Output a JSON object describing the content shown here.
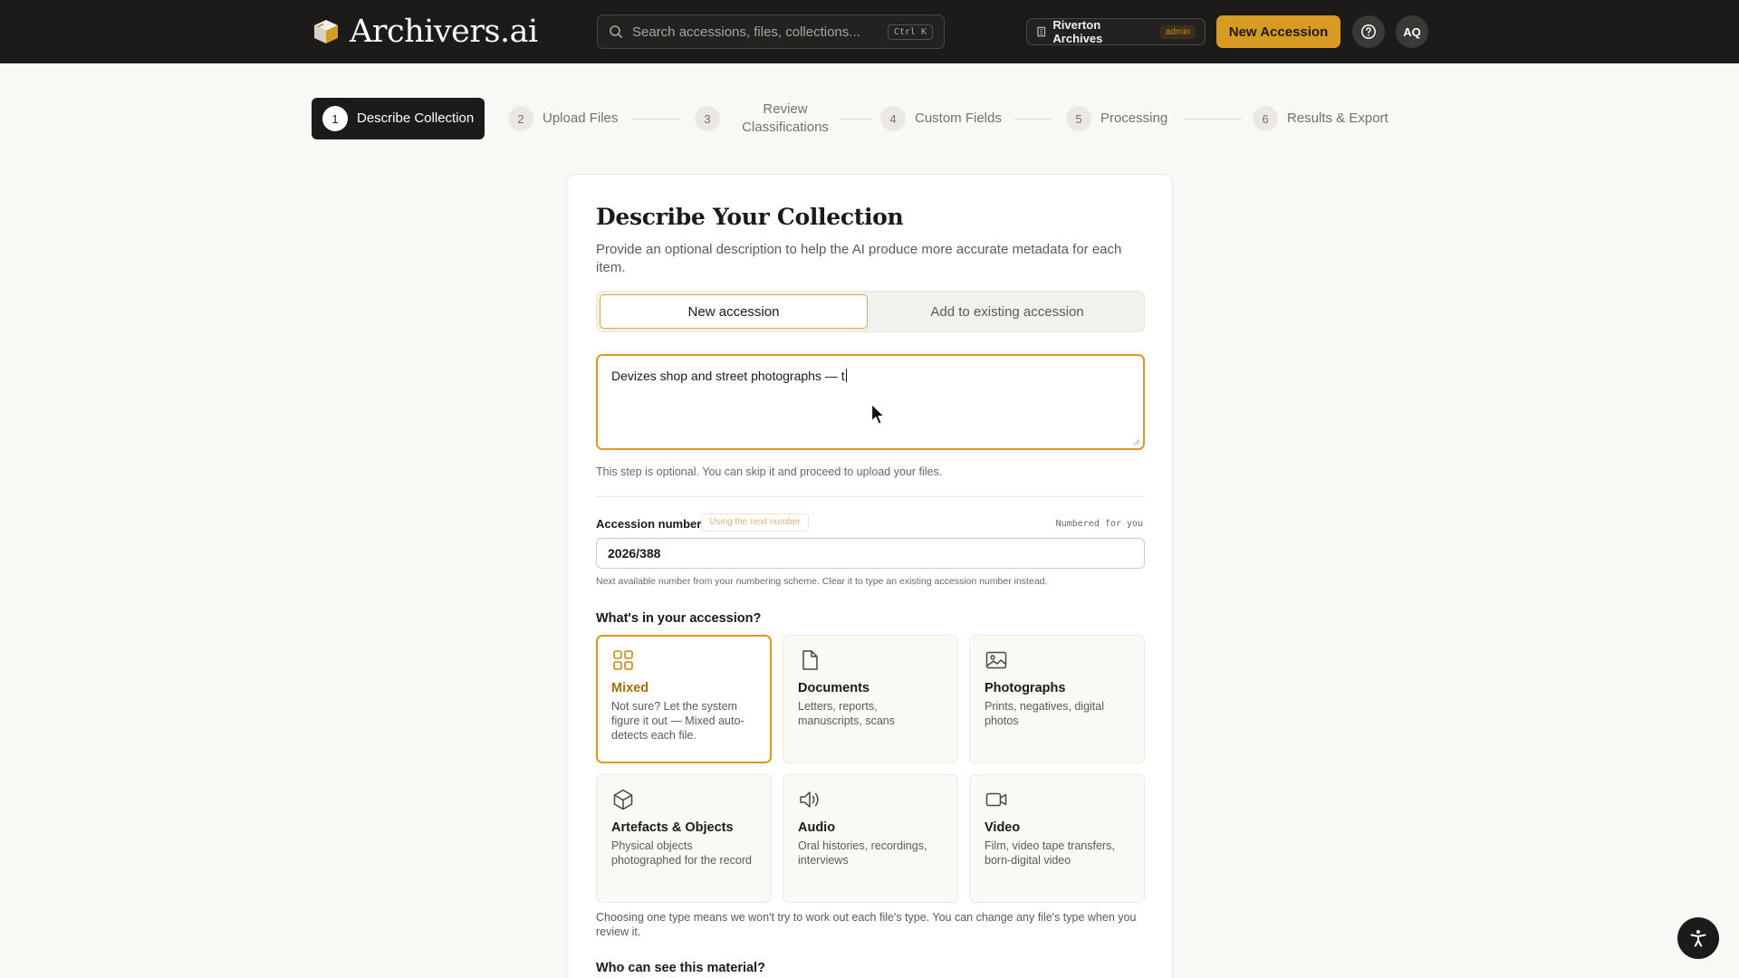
{
  "header": {
    "brand": "Archivers.ai",
    "search_placeholder": "Search accessions, files, collections...",
    "search_shortcut": "Ctrl K",
    "org_name": "Riverton Archives",
    "org_role": "admin",
    "new_accession_label": "New Accession",
    "avatar_initials": "AQ",
    "accent_color": "#d79a22"
  },
  "stepper": {
    "steps": [
      {
        "number": "1",
        "label": "Describe Collection",
        "active": true
      },
      {
        "number": "2",
        "label": "Upload Files"
      },
      {
        "number": "3",
        "label": "Review Classifications"
      },
      {
        "number": "4",
        "label": "Custom Fields"
      },
      {
        "number": "5",
        "label": "Processing"
      },
      {
        "number": "6",
        "label": "Results & Export"
      }
    ]
  },
  "main": {
    "title": "Describe Your Collection",
    "subtitle": "Provide an optional description to help the AI produce more accurate metadata for each item.",
    "mode_tabs": [
      "New accession",
      "Add to existing accession"
    ],
    "active_mode": "New accession",
    "description_value": "Devizes shop and street photographs — t",
    "optional_note": "This step is optional. You can skip it and proceed to upload your files.",
    "accession": {
      "label": "Accession number",
      "badge": "Using the next number",
      "hint": "Numbered for you",
      "value": "2026/388",
      "help": "Next available number from your numbering scheme. Clear it to type an existing accession number instead."
    },
    "type_question": "What's in your accession?",
    "types": [
      {
        "icon": "grid-icon",
        "title": "Mixed",
        "desc": "Not sure? Let the system figure it out — Mixed auto-detects each file.",
        "selected": true
      },
      {
        "icon": "document-icon",
        "title": "Documents",
        "desc": "Letters, reports, manuscripts, scans"
      },
      {
        "icon": "image-icon",
        "title": "Photographs",
        "desc": "Prints, negatives, digital photos"
      },
      {
        "icon": "cube-icon",
        "title": "Artefacts & Objects",
        "desc": "Physical objects photographed for the record"
      },
      {
        "icon": "speaker-icon",
        "title": "Audio",
        "desc": "Oral histories, recordings, interviews"
      },
      {
        "icon": "video-icon",
        "title": "Video",
        "desc": "Film, video tape transfers, born-digital video"
      }
    ],
    "type_note": "Choosing one type means we won't try to work out each file's type. You can change any file's type when you review it.",
    "visibility_question": "Who can see this material?"
  }
}
